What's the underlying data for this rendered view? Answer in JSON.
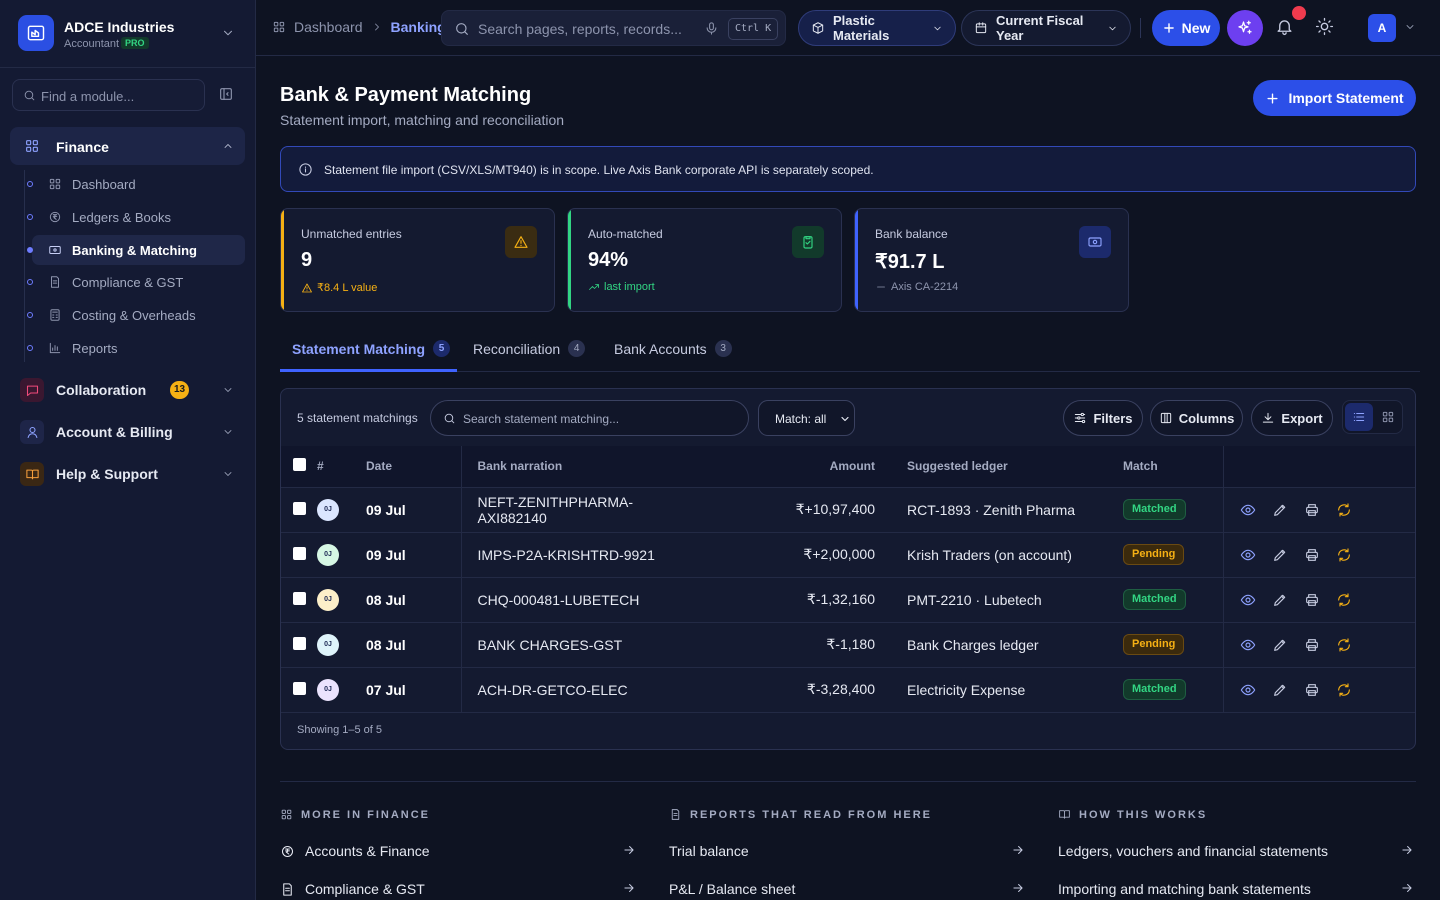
{
  "brand": {
    "name": "ADCE Industries",
    "role": "Accountant",
    "plan": "PRO"
  },
  "sidebar": {
    "find_placeholder": "Find a module...",
    "finance": {
      "label": "Finance",
      "items": [
        {
          "label": "Dashboard",
          "icon": "grid-icon"
        },
        {
          "label": "Ledgers & Books",
          "icon": "rupee-circle-icon"
        },
        {
          "label": "Banking & Matching",
          "icon": "bank-card-icon",
          "active": true
        },
        {
          "label": "Compliance & GST",
          "icon": "document-icon"
        },
        {
          "label": "Costing & Overheads",
          "icon": "calculator-icon"
        },
        {
          "label": "Reports",
          "icon": "bar-chart-icon"
        }
      ]
    },
    "groups": [
      {
        "label": "Collaboration",
        "badge": "13",
        "icon": "message-icon",
        "color": "#f04a7a"
      },
      {
        "label": "Account & Billing",
        "icon": "user-icon",
        "color": "#8ea2ff"
      },
      {
        "label": "Help & Support",
        "icon": "book-icon",
        "color": "#f59e3c"
      }
    ]
  },
  "topbar": {
    "breadcrumb": [
      "Dashboard",
      "Banking"
    ],
    "search_placeholder": "Search pages, reports, records...",
    "shortcut": "Ctrl K",
    "org": "Plastic Materials",
    "period": "Current Fiscal Year",
    "new_label": "New",
    "avatar": "A"
  },
  "page": {
    "title": "Bank & Payment Matching",
    "subtitle": "Statement import, matching and reconciliation",
    "import_label": "Import Statement",
    "notice": "Statement file import (CSV/XLS/MT940) is in scope. Live Axis Bank corporate API is separately scoped."
  },
  "kpis": [
    {
      "label": "Unmatched entries",
      "value": "9",
      "foot": "₹8.4 L value",
      "accent": "#f5b014",
      "icon": "warning-icon"
    },
    {
      "label": "Auto-matched",
      "value": "94%",
      "foot": "last import",
      "accent": "#32d583",
      "icon": "clipboard-check-icon"
    },
    {
      "label": "Bank balance",
      "value": "₹91.7 L",
      "foot": "Axis CA-2214",
      "accent": "#3f63ff",
      "icon": "banknote-icon"
    }
  ],
  "tabs": [
    {
      "label": "Statement Matching",
      "count": "5",
      "active": true
    },
    {
      "label": "Reconciliation",
      "count": "4"
    },
    {
      "label": "Bank Accounts",
      "count": "3"
    }
  ],
  "table": {
    "count_label": "5 statement matchings",
    "search_placeholder": "Search statement matching...",
    "match_filter": "Match: all",
    "filters_label": "Filters",
    "columns_label": "Columns",
    "export_label": "Export",
    "headers": [
      "#",
      "Date",
      "Bank narration",
      "Amount",
      "Suggested ledger",
      "Match"
    ],
    "rows": [
      {
        "initials": "0J",
        "avatar": "#dbe6ff",
        "date": "09 Jul",
        "narration": "NEFT-ZENITHPHARMA-AXI882140",
        "amount": "₹+10,97,400",
        "ledger": "RCT-1893 · Zenith Pharma",
        "status": "Matched"
      },
      {
        "initials": "0J",
        "avatar": "#d6f7e4",
        "date": "09 Jul",
        "narration": "IMPS-P2A-KRISHTRD-9921",
        "amount": "₹+2,00,000",
        "ledger": "Krish Traders (on account)",
        "status": "Pending"
      },
      {
        "initials": "0J",
        "avatar": "#fcefc9",
        "date": "08 Jul",
        "narration": "CHQ-000481-LUBETECH",
        "amount": "₹-1,32,160",
        "ledger": "PMT-2210 · Lubetech",
        "status": "Matched"
      },
      {
        "initials": "0J",
        "avatar": "#dff4fb",
        "date": "08 Jul",
        "narration": "BANK CHARGES-GST",
        "amount": "₹-1,180",
        "ledger": "Bank Charges ledger",
        "status": "Pending"
      },
      {
        "initials": "0J",
        "avatar": "#ebe3fd",
        "date": "07 Jul",
        "narration": "ACH-DR-GETCO-ELEC",
        "amount": "₹-3,28,400",
        "ledger": "Electricity Expense",
        "status": "Matched"
      }
    ],
    "footer": "Showing 1–5 of 5"
  },
  "more": [
    {
      "heading": "MORE IN FINANCE",
      "links": [
        "Accounts & Finance",
        "Compliance & GST"
      ]
    },
    {
      "heading": "REPORTS THAT READ FROM HERE",
      "links": [
        "Trial balance",
        "P&L / Balance sheet"
      ]
    },
    {
      "heading": "HOW THIS WORKS",
      "links": [
        "Ledgers, vouchers and financial statements",
        "Importing and matching bank statements"
      ]
    }
  ]
}
